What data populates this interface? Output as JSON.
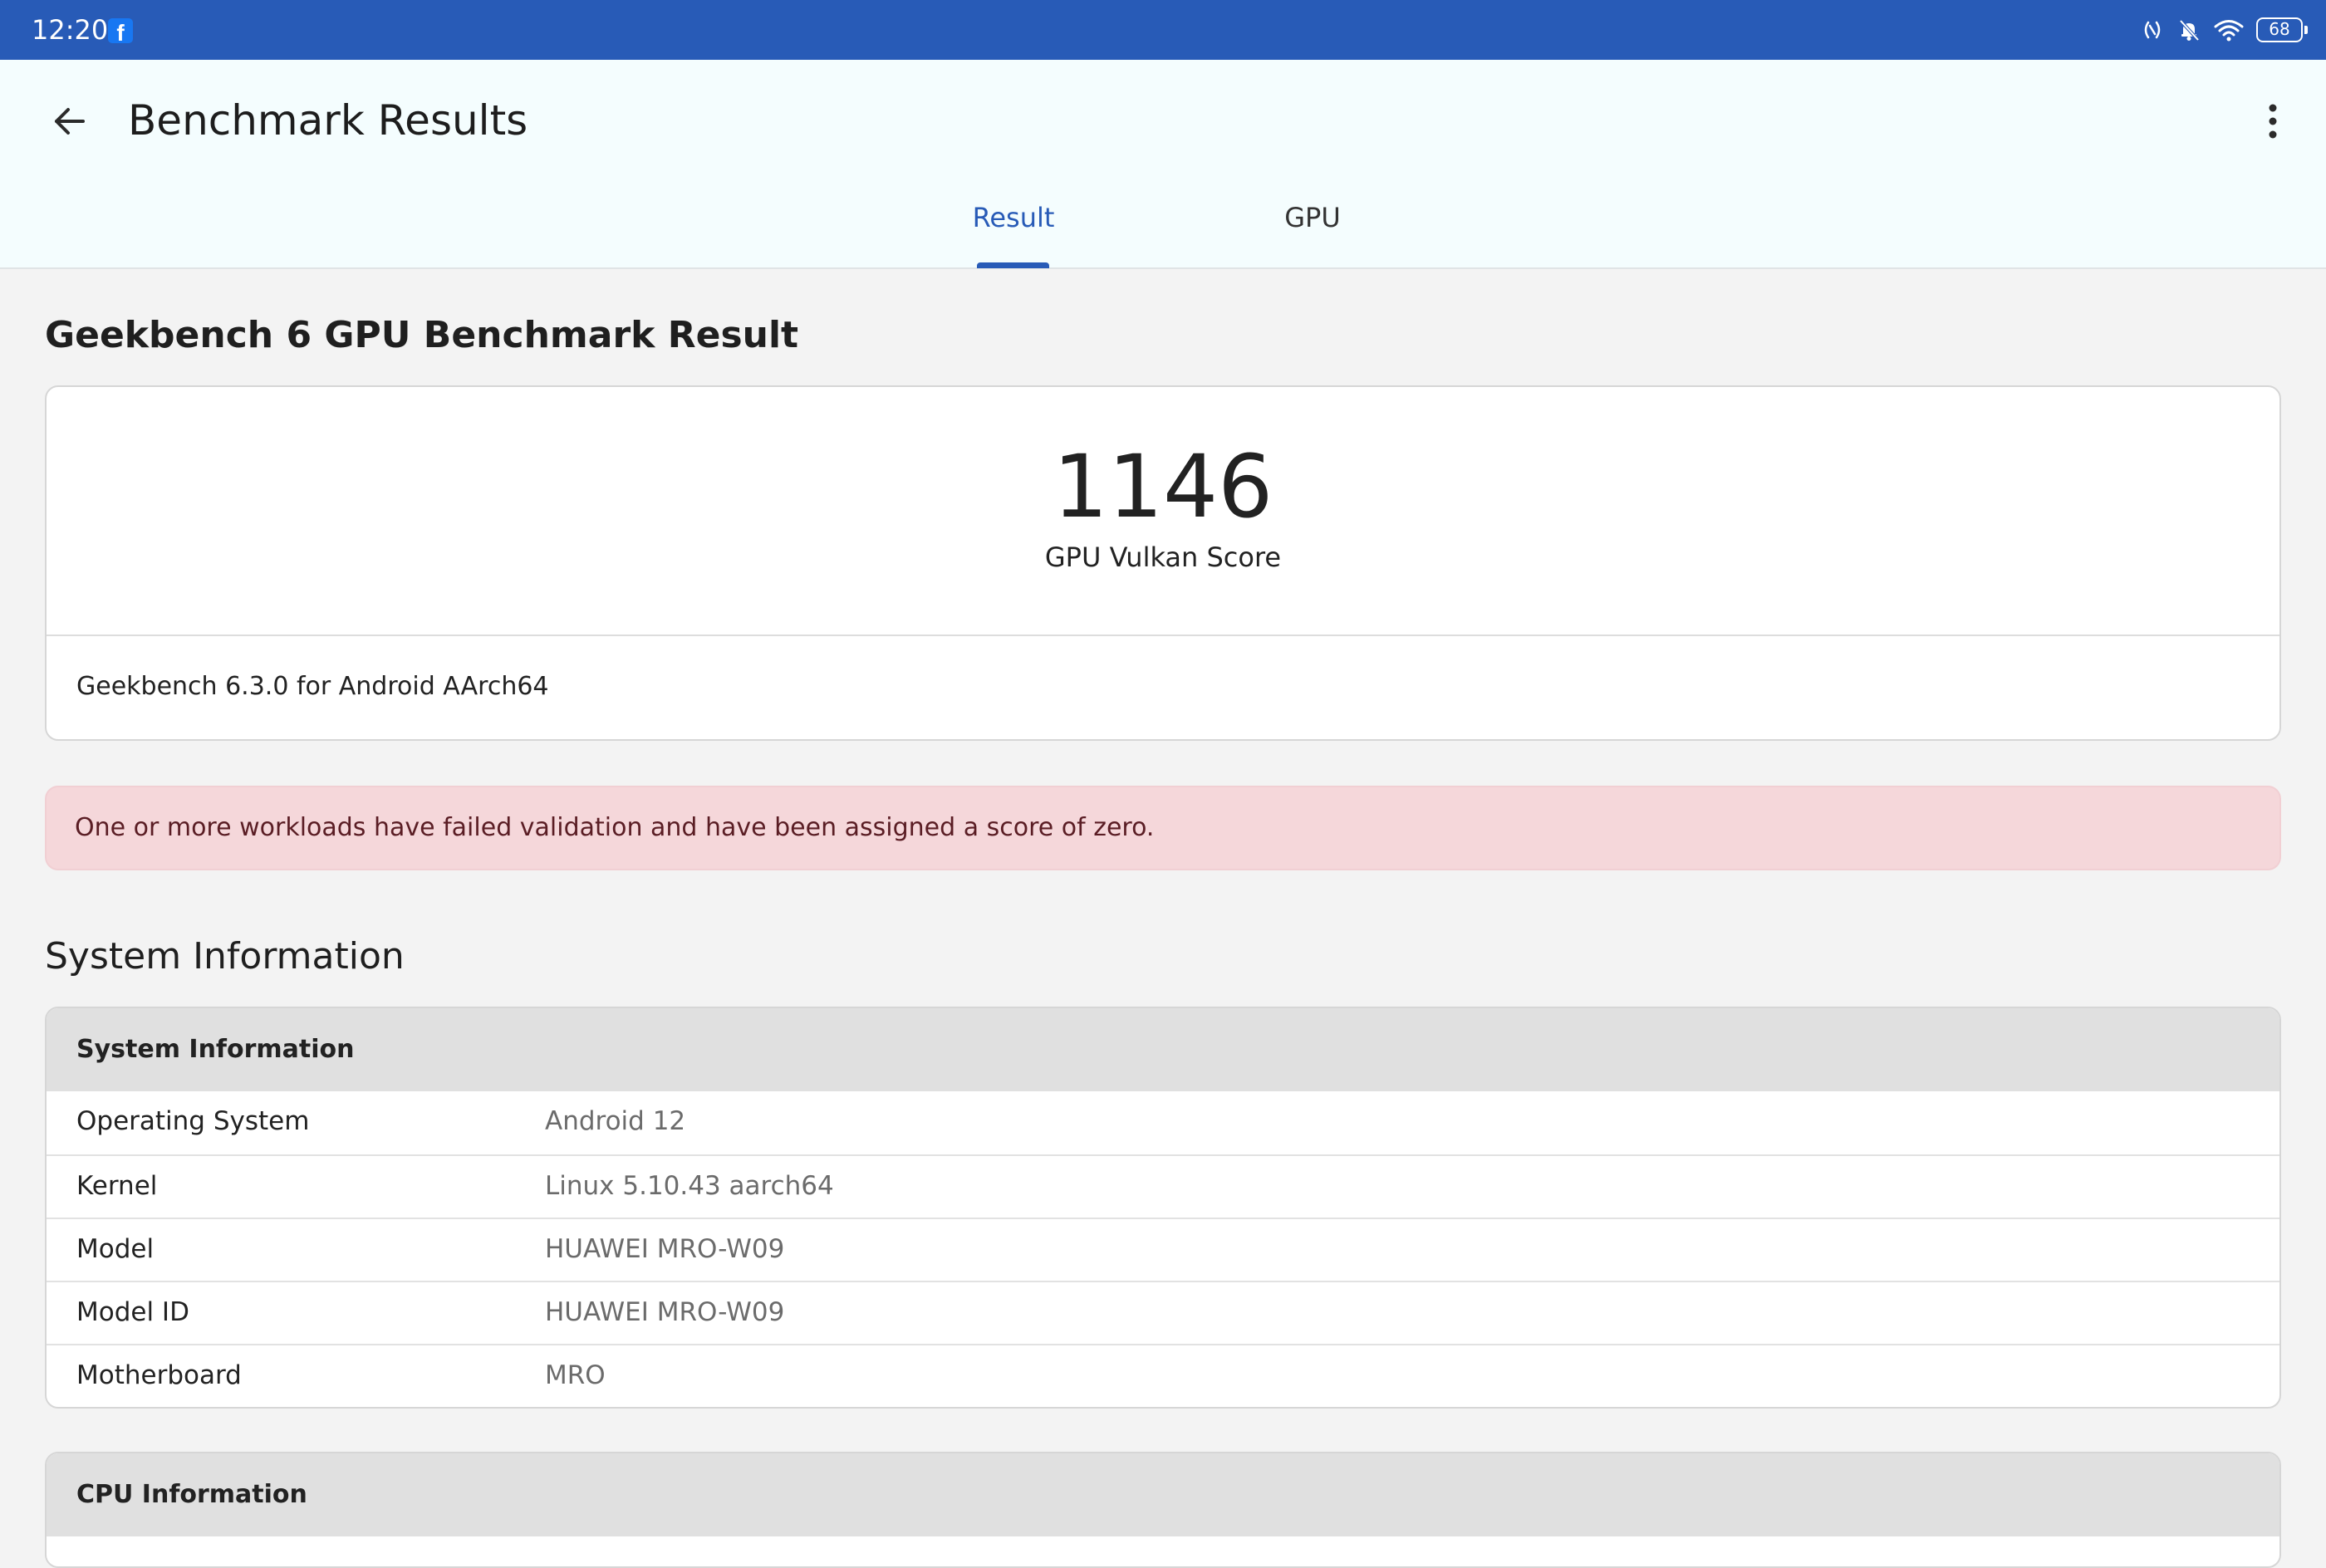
{
  "status_bar": {
    "time": "12:20",
    "battery": "68",
    "icons": [
      "facebook-icon",
      "nfc-icon",
      "bell-off-icon",
      "wifi-icon",
      "battery-icon"
    ]
  },
  "app_bar": {
    "title": "Benchmark Results",
    "tabs": [
      {
        "label": "Result",
        "selected": true
      },
      {
        "label": "GPU",
        "selected": false
      }
    ]
  },
  "benchmark": {
    "title": "Geekbench 6 GPU Benchmark Result",
    "score": "1146",
    "score_label": "GPU Vulkan Score",
    "version": "Geekbench 6.3.0 for Android AArch64"
  },
  "alert": {
    "text": "One or more workloads have failed validation and have been assigned a score of zero."
  },
  "system_information": {
    "section_title": "System Information",
    "table_header": "System Information",
    "rows": [
      {
        "label": "Operating System",
        "value": "Android 12"
      },
      {
        "label": "Kernel",
        "value": "Linux 5.10.43 aarch64"
      },
      {
        "label": "Model",
        "value": "HUAWEI MRO-W09"
      },
      {
        "label": "Model ID",
        "value": "HUAWEI MRO-W09"
      },
      {
        "label": "Motherboard",
        "value": "MRO"
      }
    ]
  },
  "cpu_information": {
    "table_header": "CPU Information"
  },
  "colors": {
    "status_bar": "#285bb7",
    "accent": "#285bb7",
    "app_bar_bg": "#f4fdfe",
    "page_bg": "#f3f3f3",
    "alert_bg": "#f5d7da",
    "alert_text": "#5a1d24",
    "table_header_bg": "#e0e0e0"
  }
}
